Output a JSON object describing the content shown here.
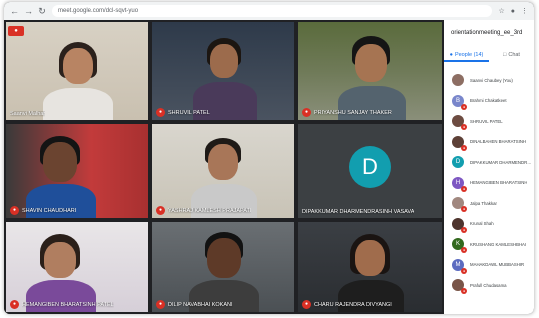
{
  "browser": {
    "url": "meet.google.com/dcl-sqvt-yuo",
    "back_icon": "back-arrow-icon",
    "forward_icon": "forward-arrow-icon",
    "reload_icon": "reload-icon"
  },
  "tiles": [
    {
      "name": "Saanvi Malhar",
      "muted": false
    },
    {
      "name": "SHRUVIL PATEL",
      "muted": true
    },
    {
      "name": "PRIYANSHU SANJAY THAKER",
      "muted": true
    },
    {
      "name": "SHAVIN CHAUDHARI",
      "muted": true
    },
    {
      "name": "YASHRAJ KAMLESH PRAJAPATI",
      "muted": true
    },
    {
      "name": "DIPAKKUMAR DHARMENDRASINH VASAVA",
      "muted": false,
      "initial": "D"
    },
    {
      "name": "HEMANGIBEN BHARATSINH PATEL",
      "muted": true
    },
    {
      "name": "DILIP NAVABHAI KOKANI",
      "muted": true
    },
    {
      "name": "CHARU RAJENDRA DIVYANGI",
      "muted": true
    }
  ],
  "panel": {
    "meeting_title": "orientationmeeting_ee_3rd",
    "tabs": [
      {
        "label": "People (14)",
        "icon": "people-icon"
      },
      {
        "label": "Chat",
        "icon": "chat-icon"
      }
    ],
    "people": [
      {
        "name": "Saanvi Chaubey (You)",
        "avatar_color": "#8d6e63",
        "initial": ""
      },
      {
        "name": "Brahmi Chakatkeet",
        "avatar_color": "#7986cb",
        "initial": "B"
      },
      {
        "name": "SHRUVIL PATEL",
        "avatar_color": "#6d4c41",
        "initial": ""
      },
      {
        "name": "DINALBAHEN BHARATSINH",
        "avatar_color": "#5d4037",
        "initial": ""
      },
      {
        "name": "DIPAKKUMAR DHARMENDRASINH",
        "avatar_color": "#129eaf",
        "initial": "D"
      },
      {
        "name": "HEMANGIBEN BHARATSINH",
        "avatar_color": "#7e57c2",
        "initial": "H"
      },
      {
        "name": "Jalpa Thakkar",
        "avatar_color": "#a1887f",
        "initial": ""
      },
      {
        "name": "Krunal Shah",
        "avatar_color": "#4e342e",
        "initial": ""
      },
      {
        "name": "KRUSHANG KAMLESHBHAI",
        "avatar_color": "#33691e",
        "initial": "K"
      },
      {
        "name": "MAHAKDAWL MUBBASHIR",
        "avatar_color": "#5c6bc0",
        "initial": "M"
      },
      {
        "name": "Prafull Chudasama",
        "avatar_color": "#795548",
        "initial": ""
      }
    ]
  }
}
